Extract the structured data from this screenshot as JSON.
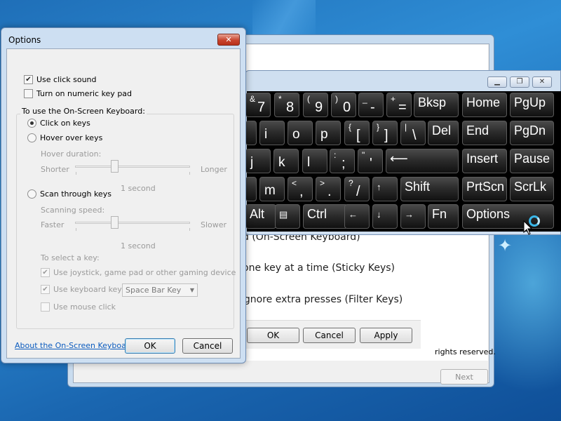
{
  "options_dialog": {
    "title": "Options",
    "close_glyph": "✕",
    "use_click_sound": "Use click sound",
    "numeric_key_pad": "Turn on numeric key pad",
    "group_label": "To use the On-Screen Keyboard:",
    "click_on_keys": "Click on keys",
    "hover_over_keys": "Hover over keys",
    "hover_duration_label": "Hover duration:",
    "hover_min": "Shorter",
    "hover_max": "Longer",
    "hover_value": "1 second",
    "scan_through_keys": "Scan through keys",
    "scanning_speed_label": "Scanning speed:",
    "scan_min": "Faster",
    "scan_max": "Slower",
    "scan_value": "1 second",
    "select_key_label": "To select a key:",
    "use_joystick": "Use joystick, game pad or other gaming device",
    "use_keyboard_key": "Use keyboard key",
    "keyboard_key_value": "Space Bar Key",
    "use_mouse_click": "Use mouse click",
    "about_link": "About the On-Screen Keyboard",
    "ok": "OK",
    "cancel": "Cancel"
  },
  "background_dialog": {
    "line1": "d (On-Screen Keyboard)",
    "line2": "one key at a time (Sticky Keys)",
    "line3": "ignore extra presses (Filter Keys)",
    "ok": "OK",
    "cancel": "Cancel",
    "apply": "Apply"
  },
  "wizard": {
    "rights": "rights reserved.",
    "next": "Next"
  },
  "osk": {
    "minimize_glyph": "▁",
    "restore_glyph": "❐",
    "close_glyph": "✕",
    "keys": {
      "k7": {
        "up": "&",
        "lo": "7"
      },
      "k8": {
        "up": "*",
        "lo": "8"
      },
      "k9": {
        "up": "(",
        "lo": "9"
      },
      "k0": {
        "up": ")",
        "lo": "0"
      },
      "kminus": {
        "up": "_",
        "lo": "-"
      },
      "kequal": {
        "up": "+",
        "lo": "="
      },
      "bksp": "Bksp",
      "home": "Home",
      "pgup": "PgUp",
      "ku": "",
      "ki": "i",
      "ko": "o",
      "kp": "p",
      "klbr": {
        "up": "{",
        "lo": "["
      },
      "krbr": {
        "up": "}",
        "lo": "]"
      },
      "kpipe": {
        "up": "|",
        "lo": "\\"
      },
      "del": "Del",
      "end": "End",
      "pgdn": "PgDn",
      "kh": "",
      "kj": "j",
      "kk": "k",
      "kl": "l",
      "ksemi": {
        "up": ":",
        "lo": ";"
      },
      "kquote": {
        "up": "\"",
        "lo": "'"
      },
      "enter": "⟵",
      "insert": "Insert",
      "pause": "Pause",
      "kn": "",
      "km": "m",
      "kcomma": {
        "up": "<",
        "lo": ","
      },
      "kperiod": {
        "up": ">",
        "lo": "."
      },
      "kslash": {
        "up": "?",
        "lo": "/"
      },
      "kuparrow": "↑",
      "shift": "Shift",
      "prtscn": "PrtScn",
      "scrlk": "ScrLk",
      "kspace": "",
      "alt": "Alt",
      "menu": "▤",
      "ctrl": "Ctrl",
      "kleft": "←",
      "kdown": "↓",
      "kright": "→",
      "fn": "Fn",
      "options": "Options"
    }
  }
}
